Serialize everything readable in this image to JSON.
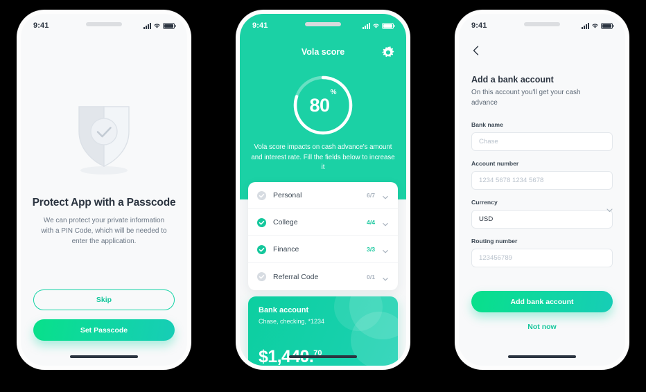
{
  "phone1": {
    "status": {
      "time": "9:41",
      "signal_icon": "signal-bars-icon",
      "wifi_icon": "wifi-icon",
      "battery_icon": "battery-icon"
    },
    "illustration": "shield-check-icon",
    "title": "Protect App with a Passcode",
    "subtitle": "We can protect your private information with a PIN Code, which will be needed to enter the application.",
    "skip_label": "Skip",
    "set_passcode_label": "Set Passcode"
  },
  "phone2": {
    "status": {
      "time": "9:41",
      "signal_icon": "signal-bars-icon",
      "wifi_icon": "wifi-icon",
      "battery_icon": "battery-icon"
    },
    "gear_icon": "gear-icon",
    "heading": "Vola score",
    "score": {
      "value": "80",
      "unit": "%",
      "percent": 80
    },
    "description": "Vola score impacts on cash advance's amount and interest rate. Fill the fields below to increase it",
    "list": [
      {
        "label": "Personal",
        "count": "6/7",
        "complete": false,
        "check_icon": "check-circle-icon",
        "chevron_icon": "chevron-down-icon"
      },
      {
        "label": "College",
        "count": "4/4",
        "complete": true,
        "check_icon": "check-circle-icon",
        "chevron_icon": "chevron-down-icon"
      },
      {
        "label": "Finance",
        "count": "3/3",
        "complete": true,
        "check_icon": "check-circle-icon",
        "chevron_icon": "chevron-down-icon"
      },
      {
        "label": "Referral Code",
        "count": "0/1",
        "complete": false,
        "check_icon": "check-circle-icon",
        "chevron_icon": "chevron-down-icon"
      }
    ],
    "card": {
      "title": "Bank account",
      "subtitle": "Chase, checking, *1234",
      "amount_main": "$1,440.",
      "amount_cents": "70"
    }
  },
  "phone3": {
    "status": {
      "time": "9:41",
      "signal_icon": "signal-bars-icon",
      "wifi_icon": "wifi-icon",
      "battery_icon": "battery-icon"
    },
    "back_icon": "chevron-left-icon",
    "title": "Add a bank account",
    "subtitle": "On this account you'll get your cash advance",
    "fields": [
      {
        "label": "Bank name",
        "value": "",
        "placeholder": "Chase",
        "filled": false
      },
      {
        "label": "Account number",
        "value": "",
        "placeholder": "1234 5678 1234 5678",
        "filled": false
      },
      {
        "label": "Currency",
        "value": "USD",
        "placeholder": "USD",
        "filled": true,
        "chevron_icon": "chevron-down-icon"
      },
      {
        "label": "Routing number",
        "value": "",
        "placeholder": "123456789",
        "filled": false
      }
    ],
    "submit_label": "Add bank account",
    "not_now_label": "Not now"
  },
  "colors": {
    "accent": "#14c79c",
    "teal": "#1bd1a5",
    "gradient_start": "#08e08a",
    "gradient_end": "#17cdb6",
    "dark_text": "#2b3440",
    "muted_text": "#6b7785",
    "placeholder": "#b9c2cc",
    "canvas": "#000000",
    "screen_bg": "#f8f9fa"
  }
}
